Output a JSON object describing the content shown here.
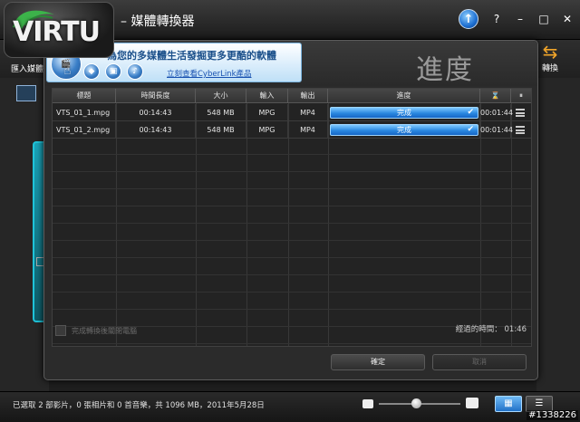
{
  "app": {
    "logo_text": "VIRTU",
    "title": "– 媒體轉換器",
    "window_controls": [
      "?",
      "–",
      "□",
      "✕"
    ]
  },
  "toolbar": {
    "import_label": "匯入媒體",
    "convert_label": "轉換"
  },
  "dialog": {
    "title": "進度",
    "ad": {
      "headline": "為您的多媒體生活發掘更多更酷的軟體",
      "link": "立刻查看CyberLink產品"
    },
    "columns": [
      "標題",
      "時間長度",
      "大小",
      "輸入",
      "輸出",
      "進度",
      "⌛",
      "⏸"
    ],
    "rows": [
      {
        "title": "VTS_01_1.mpg",
        "duration": "00:14:43",
        "size": "548 MB",
        "input": "MPG",
        "output": "MP4",
        "status": "完成",
        "elapsed": "00:01:44"
      },
      {
        "title": "VTS_01_2.mpg",
        "duration": "00:14:43",
        "size": "548 MB",
        "input": "MPG",
        "output": "MP4",
        "status": "完成",
        "elapsed": "00:01:44"
      }
    ],
    "shutdown_label": "完成轉換後關閉電腦",
    "elapsed_label": "經過的時間：  01:46",
    "ok_label": "確定",
    "cancel_label": "取消"
  },
  "status_bar": {
    "text": "已選取 2 部影片，0 張相片和 0 首音樂，共 1096 MB，2011年5月28日"
  },
  "watermark": "#1338226",
  "colors": {
    "progress_fill": "#2a88e0",
    "accent_orange": "#f2a62a"
  }
}
